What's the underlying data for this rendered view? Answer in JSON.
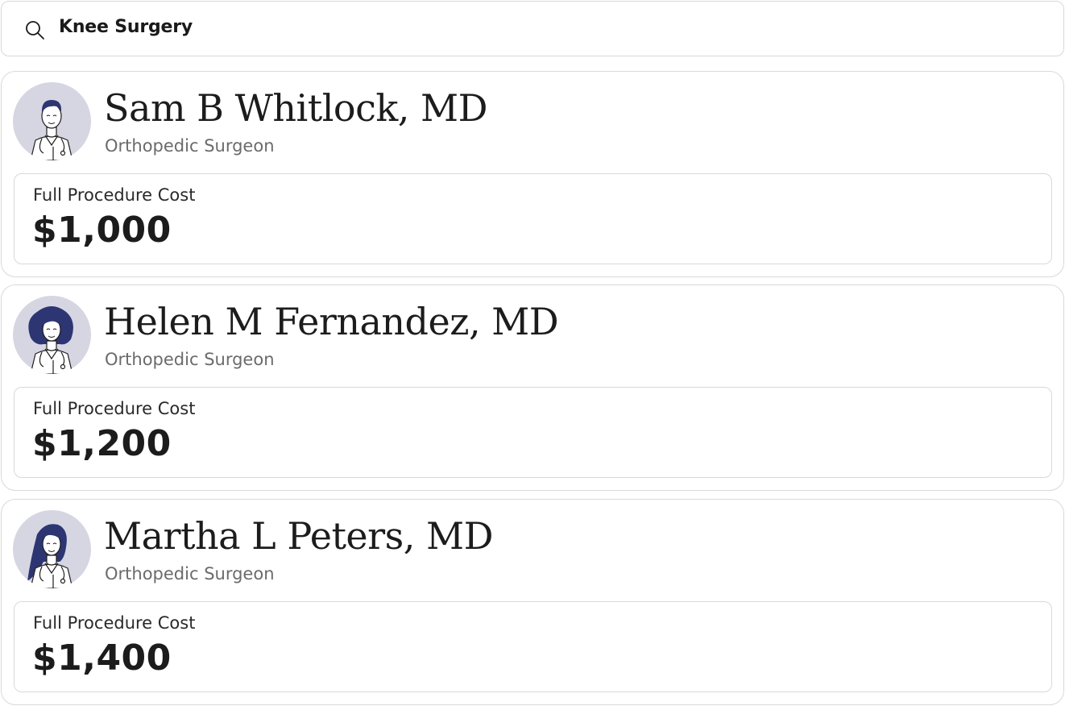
{
  "search": {
    "query": "Knee Surgery",
    "icon": "search-icon"
  },
  "colors": {
    "border": "#d9d9de",
    "avatar_bg": "#d6d6e3",
    "hair": "#2d3672",
    "specialty_text": "#6b6b6b"
  },
  "doctors": [
    {
      "name": "Sam B Whitlock, MD",
      "specialty": "Orthopedic Surgeon",
      "cost_label": "Full Procedure Cost",
      "cost": "$1,000",
      "avatar": "male-doctor-avatar"
    },
    {
      "name": "Helen M Fernandez, MD",
      "specialty": "Orthopedic Surgeon",
      "cost_label": "Full Procedure Cost",
      "cost": "$1,200",
      "avatar": "female-doctor-curly-avatar"
    },
    {
      "name": "Martha L Peters, MD",
      "specialty": "Orthopedic Surgeon",
      "cost_label": "Full Procedure Cost",
      "cost": "$1,400",
      "avatar": "female-doctor-long-hair-avatar"
    }
  ]
}
